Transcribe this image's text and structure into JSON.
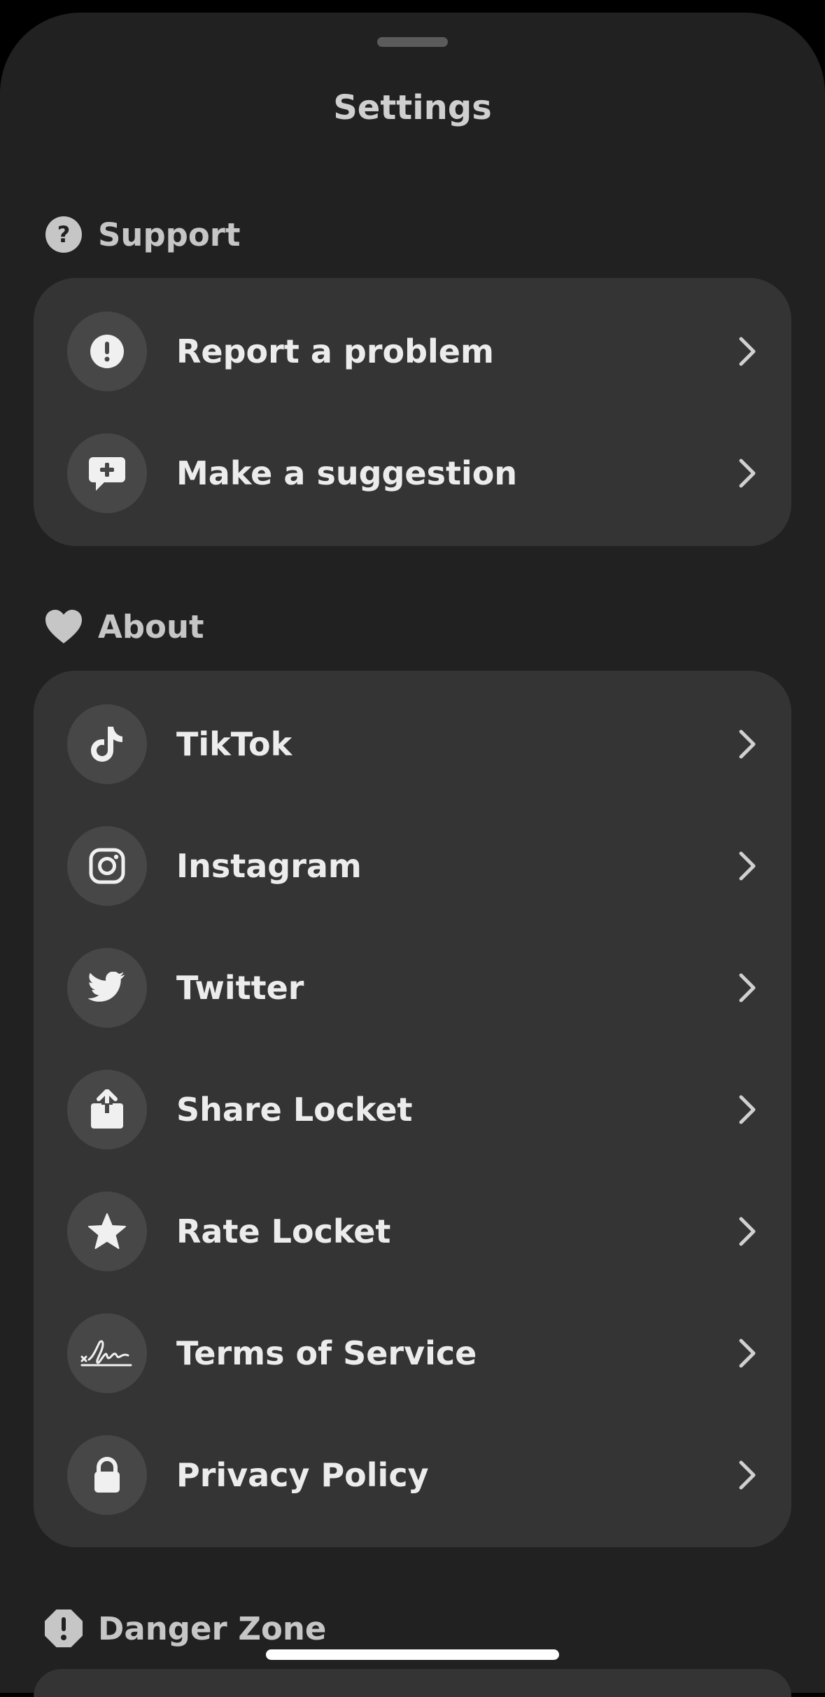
{
  "title": "Settings",
  "sections": {
    "support": {
      "header": "Support",
      "items": [
        {
          "label": "Report a problem",
          "icon": "exclamation-icon"
        },
        {
          "label": "Make a suggestion",
          "icon": "suggestion-bubble-icon"
        }
      ]
    },
    "about": {
      "header": "About",
      "items": [
        {
          "label": "TikTok",
          "icon": "tiktok-icon"
        },
        {
          "label": "Instagram",
          "icon": "instagram-icon"
        },
        {
          "label": "Twitter",
          "icon": "twitter-bird-icon"
        },
        {
          "label": "Share Locket",
          "icon": "share-icon"
        },
        {
          "label": "Rate Locket",
          "icon": "star-icon"
        },
        {
          "label": "Terms of Service",
          "icon": "signature-icon"
        },
        {
          "label": "Privacy Policy",
          "icon": "lock-icon"
        }
      ]
    },
    "danger": {
      "header": "Danger Zone"
    }
  },
  "colors": {
    "background": "#212121",
    "card": "#343434",
    "icon_circle": "#474747",
    "text": "#ececec",
    "header_text": "#c6c6c6"
  }
}
